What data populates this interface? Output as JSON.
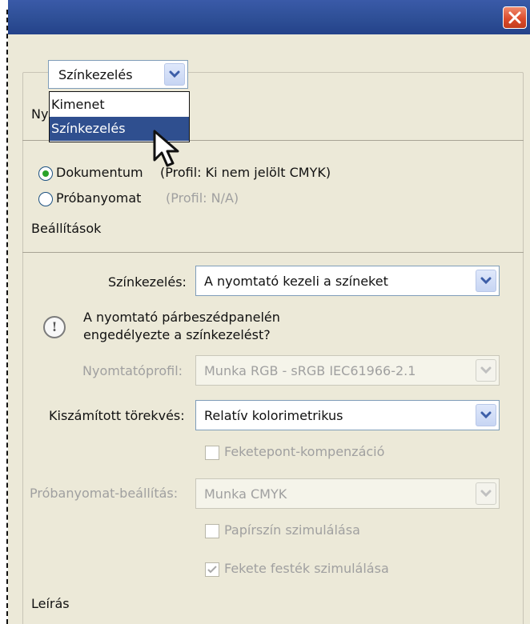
{
  "window": {
    "close_label": "Close"
  },
  "header_combo": {
    "value": "Színkezelés"
  },
  "dropdown": {
    "items": [
      "Kimenet",
      "Színkezelés"
    ]
  },
  "truncated_heading": "Ny",
  "print_section": {
    "radio_document": {
      "label": "Dokumentum",
      "profile": "(Profil: Ki nem jelölt CMYK)"
    },
    "radio_proof": {
      "label": "Próbanyomat",
      "profile": "(Profil: N/A)"
    }
  },
  "settings_heading": "Beállítások",
  "color_handling": {
    "label": "Színkezelés:",
    "value": "A nyomtató kezeli a színeket"
  },
  "info_message": {
    "line1": "A nyomtató párbeszédpanelén",
    "line2": "engedélyezte a színkezelést?"
  },
  "printer_profile": {
    "label": "Nyomtatóprofil:",
    "value": "Munka RGB - sRGB IEC61966-2.1"
  },
  "rendering_intent": {
    "label": "Kiszámított törekvés:",
    "value": "Relatív kolorimetrikus"
  },
  "black_point": {
    "label": "Feketepont-kompenzáció"
  },
  "proof_setup": {
    "label": "Próbanyomat-beállítás:",
    "value": "Munka CMYK"
  },
  "simulate_paper": {
    "label": "Papírszín szimulálása"
  },
  "simulate_black_ink": {
    "label": "Fekete festék szimulálása"
  },
  "description_heading": "Leírás"
}
